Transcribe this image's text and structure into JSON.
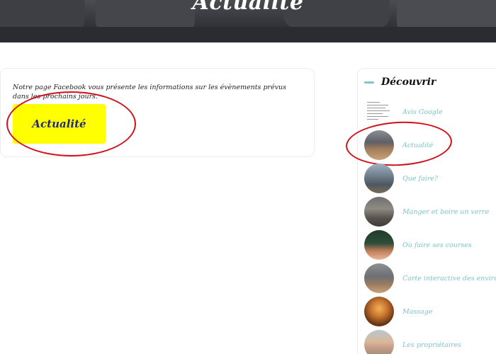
{
  "hero": {
    "title": "Actualité"
  },
  "main": {
    "intro": "Notre page Facebook vous présente les informations sur les évènements prévus dans les prochains jours.",
    "cta_label": "Actualité"
  },
  "sidebar": {
    "title": "Découvrir",
    "items": [
      {
        "label": "Avis Google",
        "icon": "document-thumbnail"
      },
      {
        "label": "Actualité",
        "icon": "living-room-thumbnail"
      },
      {
        "label": "Que faire?",
        "icon": "town-thumbnail"
      },
      {
        "label": "Manger et boire un verre",
        "icon": "restaurant-thumbnail"
      },
      {
        "label": "Où faire ses courses",
        "icon": "epicerie-thumbnail"
      },
      {
        "label": "Carte interactive des environs",
        "icon": "room-thumbnail"
      },
      {
        "label": "Massage",
        "icon": "massage-thumbnail"
      },
      {
        "label": "Les propriétaires",
        "icon": "owners-thumbnail"
      }
    ]
  },
  "colors": {
    "cta_background": "#ffff00",
    "cta_text": "#232a7a",
    "sidebar_link": "#7fc3c4",
    "annotation_ring": "#d0101a"
  }
}
